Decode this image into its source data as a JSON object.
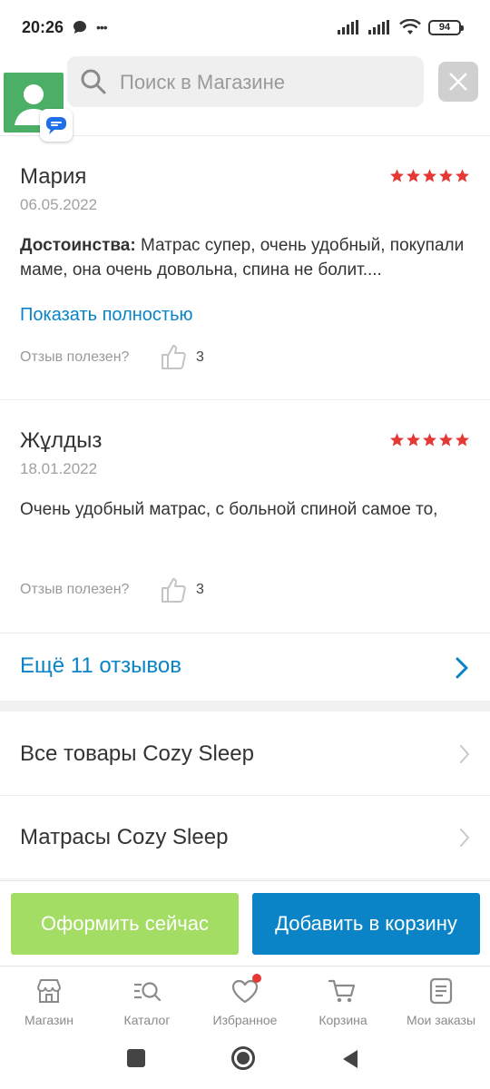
{
  "status_bar": {
    "time": "20:26",
    "more": "•••",
    "battery": "94"
  },
  "search": {
    "placeholder": "Поиск в Магазине"
  },
  "reviews": [
    {
      "author": "Мария",
      "date": "06.05.2022",
      "rating": 5,
      "pros_label": "Достоинства:",
      "text": " Матрас супер, очень удобный, покупали маме, она очень довольна, спина не болит....",
      "show_full": "Показать полностью",
      "helpful_label": "Отзыв полезен?",
      "helpful_count": "3"
    },
    {
      "author": "Жұлдыз",
      "date": "18.01.2022",
      "rating": 5,
      "text": "Очень удобный матрас, с больной спиной самое то,",
      "helpful_label": "Отзыв полезен?",
      "helpful_count": "3"
    }
  ],
  "more_reviews": "Ещё 11 отзывов",
  "links": [
    {
      "label": "Все товары Cozy Sleep"
    },
    {
      "label": "Матрасы Cozy Sleep"
    }
  ],
  "actions": {
    "buy_now": "Оформить сейчас",
    "add_to_cart": "Добавить в корзину"
  },
  "bottom_nav": [
    {
      "label": "Магазин",
      "icon": "shop-icon"
    },
    {
      "label": "Каталог",
      "icon": "catalog-icon"
    },
    {
      "label": "Избранное",
      "icon": "heart-icon"
    },
    {
      "label": "Корзина",
      "icon": "cart-icon"
    },
    {
      "label": "Мои заказы",
      "icon": "orders-icon"
    }
  ],
  "colors": {
    "accent": "#0a84c6",
    "buy_button": "#a4dd63",
    "stars": "#e53935"
  }
}
